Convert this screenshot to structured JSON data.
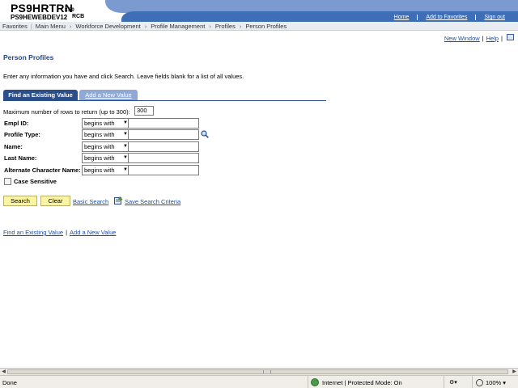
{
  "header": {
    "system_name": "PS9HRTRN",
    "version": "8.50",
    "database": "PS9HEWEBDEV12",
    "site": "RCB",
    "links": [
      "Home",
      "Add to Favorites",
      "Sign out"
    ]
  },
  "breadcrumb": {
    "favorites": "Favorites",
    "main_menu": "Main Menu",
    "items": [
      "Workforce Development",
      "Profile Management",
      "Profiles",
      "Person Profiles"
    ]
  },
  "utility": {
    "new_window": "New Window",
    "help": "Help"
  },
  "page": {
    "title": "Person Profiles",
    "instructions": "Enter any information you have and click Search. Leave fields blank for a list of all values."
  },
  "tabs": {
    "find": "Find an Existing Value",
    "add": "Add a New Value"
  },
  "form": {
    "max_rows_label": "Maximum number of rows to return (up to 300):",
    "max_rows_value": "300",
    "fields": [
      {
        "label": "Empl ID:",
        "operator": "begins with",
        "value": ""
      },
      {
        "label": "Profile Type:",
        "operator": "begins with",
        "value": ""
      },
      {
        "label": "Name:",
        "operator": "begins with",
        "value": ""
      },
      {
        "label": "Last Name:",
        "operator": "begins with",
        "value": ""
      },
      {
        "label": "Alternate Character Name:",
        "operator": "begins with",
        "value": ""
      }
    ],
    "case_sensitive": "Case Sensitive"
  },
  "actions": {
    "search": "Search",
    "clear": "Clear",
    "basic_search": "Basic Search",
    "save_criteria": "Save Search Criteria"
  },
  "bottom_links": {
    "find": "Find an Existing Value",
    "add": "Add a New Value"
  },
  "status_bar": {
    "state": "Done",
    "zone": "Internet | Protected Mode: On",
    "zoom": "100%"
  }
}
